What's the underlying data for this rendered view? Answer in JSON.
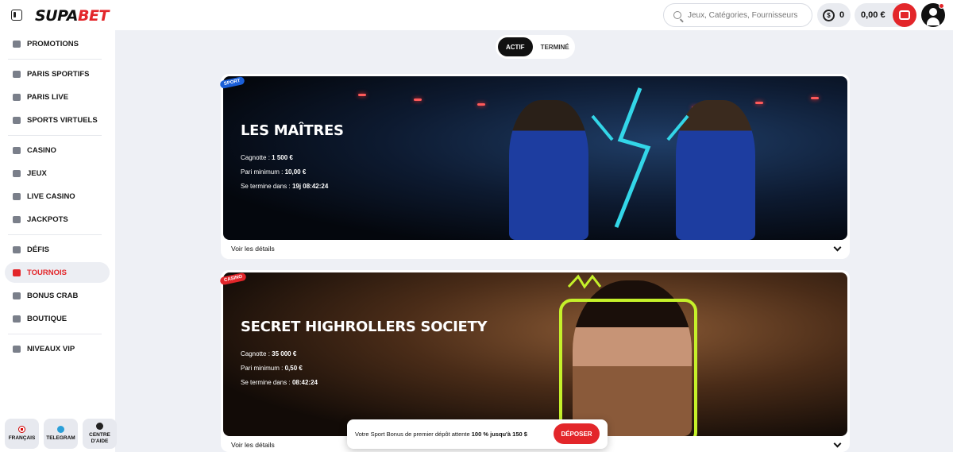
{
  "header": {
    "logo_main": "SUPA",
    "logo_accent": "BET",
    "search_placeholder": "Jeux, Catégories, Fournisseurs",
    "coins_count": "0",
    "balance": "0,00 €"
  },
  "sidebar": {
    "items": [
      {
        "label": "PROMOTIONS"
      },
      {
        "label": "PARIS SPORTIFS"
      },
      {
        "label": "PARIS LIVE"
      },
      {
        "label": "SPORTS VIRTUELS"
      },
      {
        "label": "CASINO"
      },
      {
        "label": "JEUX"
      },
      {
        "label": "LIVE CASINO"
      },
      {
        "label": "JACKPOTS"
      },
      {
        "label": "DÉFIS"
      },
      {
        "label": "TOURNOIS"
      },
      {
        "label": "BONUS CRAB"
      },
      {
        "label": "BOUTIQUE"
      },
      {
        "label": "NIVEAUX VIP"
      }
    ],
    "active_item": "TOURNOIS",
    "footer": {
      "language": "FRANÇAIS",
      "telegram": "TELEGRAM",
      "help_line1": "CENTRE",
      "help_line2": "D'AIDE"
    }
  },
  "tabs": [
    {
      "label": "ACTIF",
      "active": true
    },
    {
      "label": "TERMINÉ",
      "active": false
    }
  ],
  "tournaments": [
    {
      "badge": "SPORT",
      "title": "LES MAÎTRES",
      "pot_label": "Cagnotte :",
      "pot_value": "1 500 €",
      "min_bet_label": "Pari minimum :",
      "min_bet_value": "10,00 €",
      "ends_label": "Se termine dans :",
      "ends_value": "19j 08:42:24",
      "details": "Voir les détails"
    },
    {
      "badge": "CASINO",
      "title": "SECRET HIGHROLLERS SOCIETY",
      "pot_label": "Cagnotte :",
      "pot_value": "35 000 €",
      "min_bet_label": "Pari minimum :",
      "min_bet_value": "0,50 €",
      "ends_label": "Se termine dans :",
      "ends_value": "08:42:24",
      "details": "Voir les détails"
    }
  ],
  "deposit_banner": {
    "text_before": "Votre Sport Bonus de premier dépôt attente ",
    "text_bold": "100 % jusqu'à",
    "text_after": " 150 $",
    "button": "DÉPOSER"
  },
  "colors": {
    "accent": "#e3262a",
    "sport_badge": "#1a5fd8",
    "background": "#eef0f5"
  }
}
